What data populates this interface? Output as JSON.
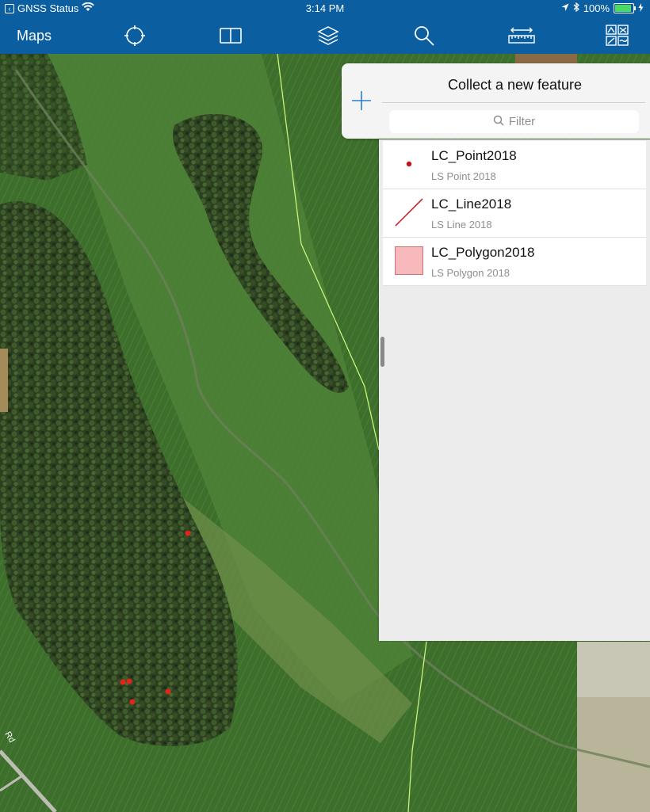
{
  "status": {
    "carrier": "GNSS Status",
    "time": "3:14 PM",
    "battery": "100%"
  },
  "toolbar": {
    "title": "Maps",
    "icons": [
      "locate-icon",
      "bookmark-icon",
      "layers-icon",
      "search-icon",
      "measure-icon",
      "basemap-icon"
    ]
  },
  "map": {
    "road_label": "Rd",
    "marker_color": "#e0251b"
  },
  "panel": {
    "title": "Collect a new feature",
    "filter_placeholder": "Filter",
    "features": [
      {
        "name": "LC_Point2018",
        "subtitle": "LS Point 2018",
        "icon": "point-symbol-icon"
      },
      {
        "name": "LC_Line2018",
        "subtitle": "LS Line 2018",
        "icon": "line-symbol-icon"
      },
      {
        "name": "LC_Polygon2018",
        "subtitle": "LS Polygon 2018",
        "icon": "polygon-symbol-icon"
      }
    ]
  },
  "colors": {
    "accent": "#0b5fa1",
    "point": "#c0141a",
    "polygon_fill": "#f8b9bd",
    "polygon_stroke": "#d0706f"
  }
}
